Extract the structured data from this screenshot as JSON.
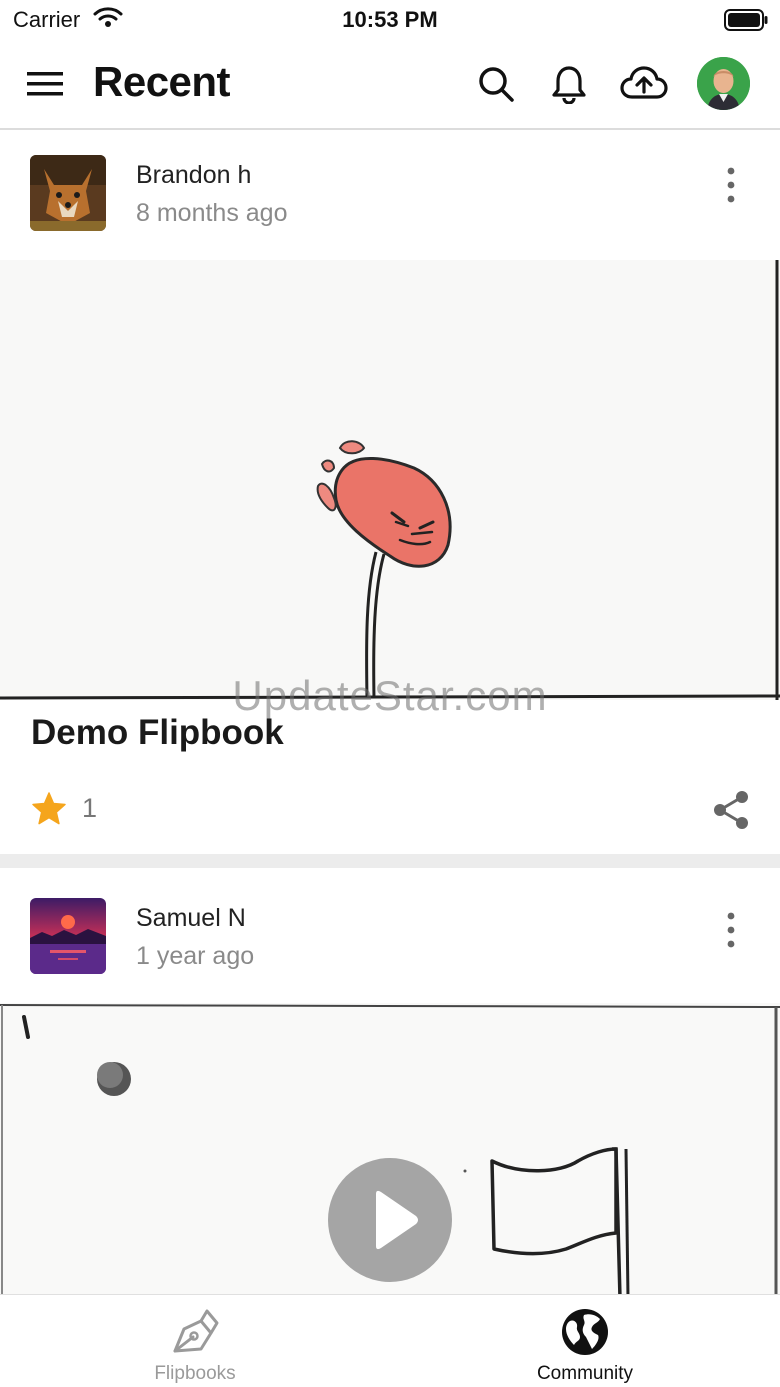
{
  "status_bar": {
    "carrier": "Carrier",
    "time": "10:53 PM"
  },
  "header": {
    "title": "Recent"
  },
  "icons": {
    "menu": "menu-icon",
    "search": "search-icon",
    "notifications": "bell-icon",
    "upload": "cloud-upload-icon",
    "profile": "avatar",
    "more": "more-vertical-icon",
    "star": "star-icon",
    "share": "share-icon",
    "play": "play-icon"
  },
  "posts": [
    {
      "author": "Brandon h",
      "time": "8 months ago",
      "title": "Demo Flipbook",
      "stars": "1"
    },
    {
      "author": "Samuel N",
      "time": "1 year ago"
    }
  ],
  "watermark": "UpdateStar.com",
  "tabs": [
    {
      "label": "Flipbooks",
      "active": false
    },
    {
      "label": "Community",
      "active": true
    }
  ],
  "colors": {
    "star": "#f5a51c",
    "avatar_bg": "#3aa34a",
    "inactive_tab": "#9a9a9a",
    "active_tab": "#111111"
  }
}
